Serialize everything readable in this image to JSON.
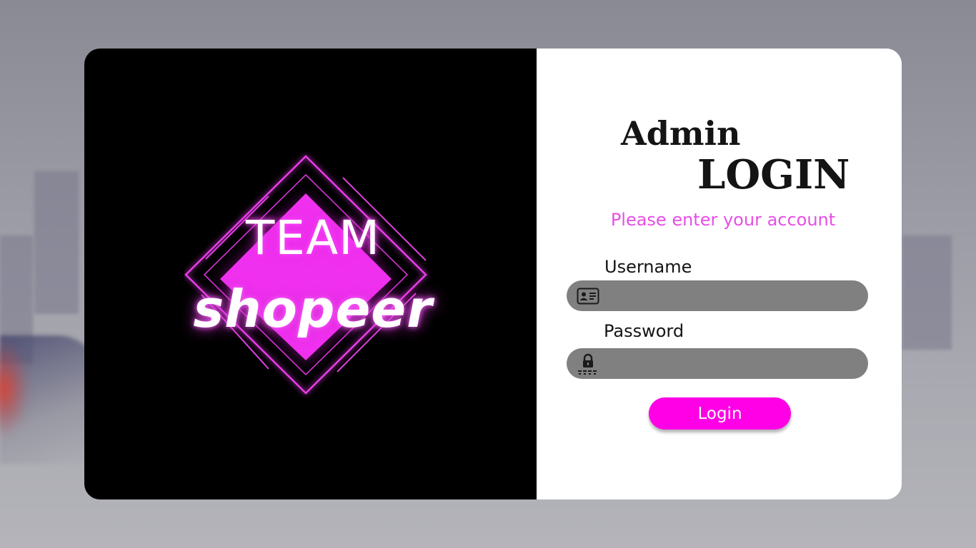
{
  "brand": {
    "logo_line1": "TEAM",
    "logo_line2": "shopeer",
    "accent_color": "#ff00e6",
    "glow_color": "#e22be2"
  },
  "login": {
    "title_line1": "Admin",
    "title_line2": "LOGIN",
    "subtitle": "Please enter your account",
    "username_label": "Username",
    "username_value": "",
    "username_icon": "id-card-icon",
    "password_label": "Password",
    "password_value": "",
    "password_icon": "lock-icon",
    "submit_label": "Login"
  },
  "colors": {
    "input_background": "#808080",
    "subtitle": "#e64fe6",
    "button": "#ff00e6",
    "left_panel": "#000000"
  }
}
